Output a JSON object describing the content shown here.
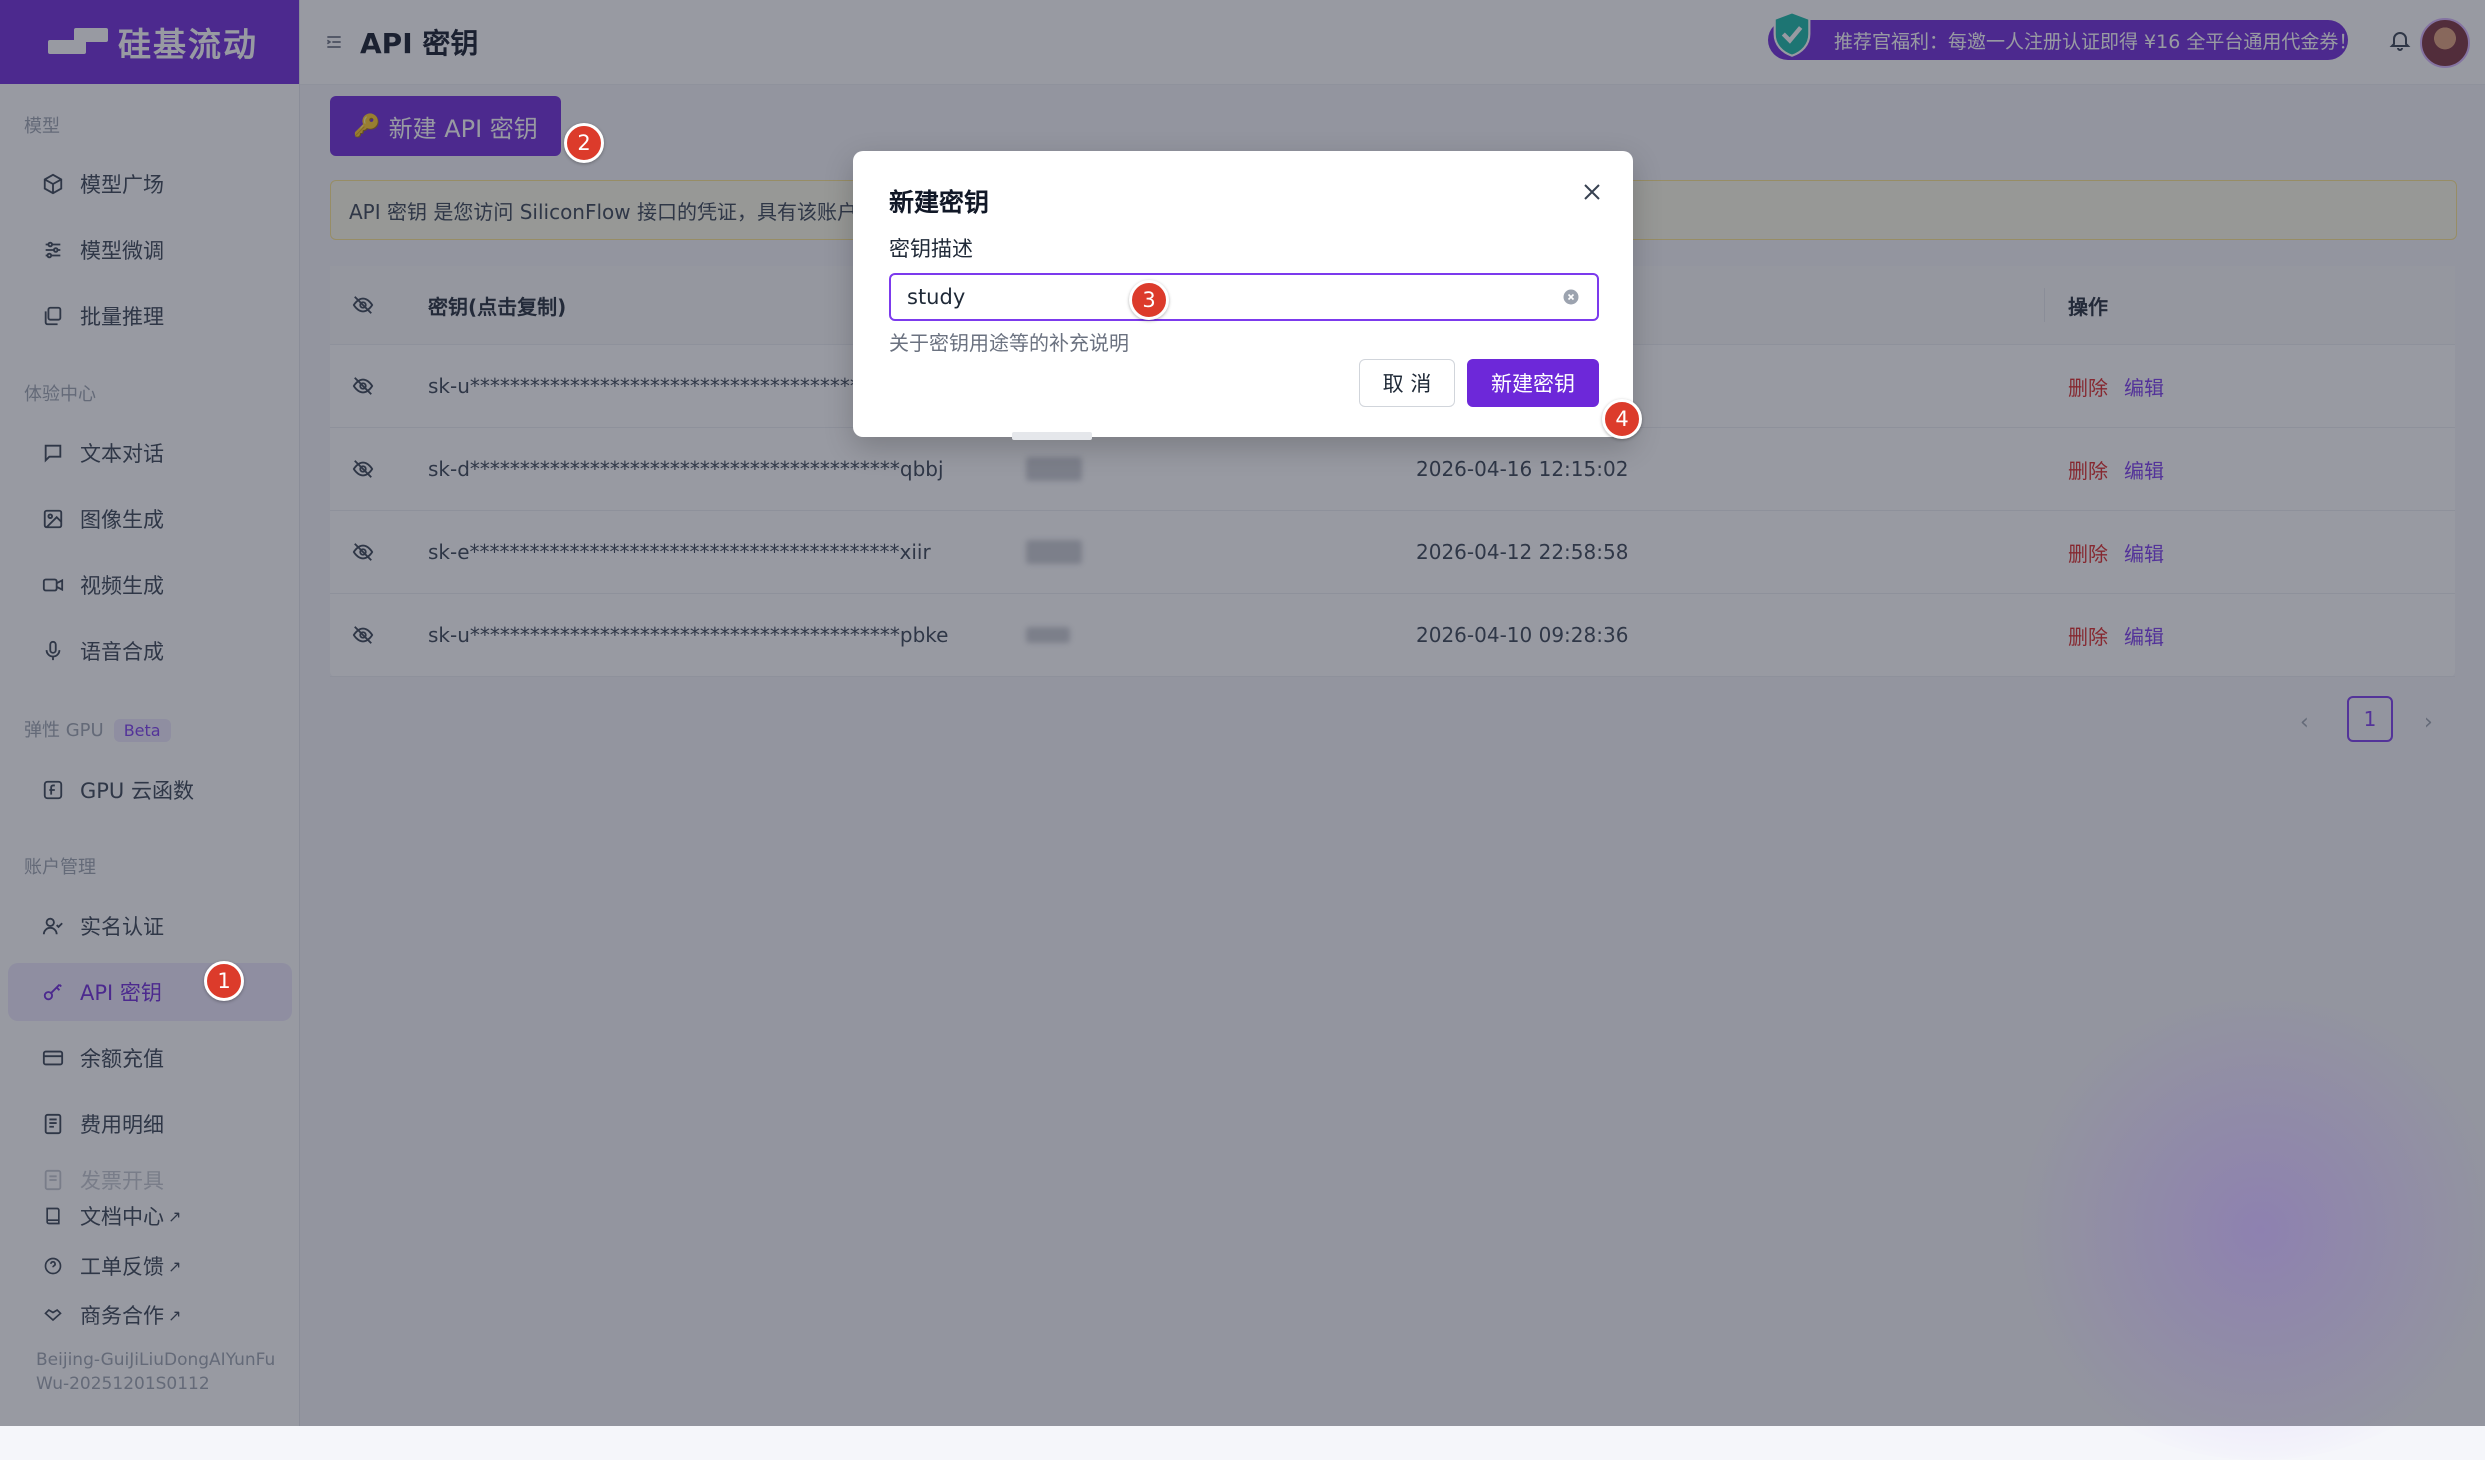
{
  "brand": {
    "name": "硅基流动"
  },
  "header": {
    "title": "API 密钥",
    "promo_text": "推荐官福利：每邀一人注册认证即得 ¥16 全平台通用代金券！"
  },
  "sidebar": {
    "sections": {
      "models": "模型",
      "experience": "体验中心",
      "gpu": "弹性 GPU",
      "gpu_badge": "Beta",
      "account": "账户管理"
    },
    "items": [
      {
        "label": "模型广场",
        "icon": "cube-icon"
      },
      {
        "label": "模型微调",
        "icon": "sliders-icon"
      },
      {
        "label": "批量推理",
        "icon": "stack-icon"
      },
      {
        "label": "文本对话",
        "icon": "chat-icon"
      },
      {
        "label": "图像生成",
        "icon": "image-icon"
      },
      {
        "label": "视频生成",
        "icon": "video-icon"
      },
      {
        "label": "语音合成",
        "icon": "mic-icon"
      },
      {
        "label": "GPU 云函数",
        "icon": "function-icon"
      },
      {
        "label": "实名认证",
        "icon": "user-check-icon"
      },
      {
        "label": "API 密钥",
        "icon": "key-icon"
      },
      {
        "label": "余额充值",
        "icon": "card-icon"
      },
      {
        "label": "费用明细",
        "icon": "receipt-icon"
      },
      {
        "label": "发票开具",
        "icon": "invoice-icon"
      }
    ],
    "links": [
      {
        "label": "文档中心",
        "suffix": "↗"
      },
      {
        "label": "工单反馈",
        "suffix": "↗"
      },
      {
        "label": "商务合作",
        "suffix": "↗"
      }
    ],
    "footer_id": "Beijing-GuiJiLiuDongAIYunFuWu-20251201S0112"
  },
  "main": {
    "new_key_button": "新建 API 密钥",
    "notice_text": "API 密钥 是您访问 SiliconFlow 接口的凭证，具有该账户",
    "table": {
      "headers": {
        "key": "密钥(点击复制)",
        "actions": "操作"
      },
      "rows": [
        {
          "key": "sk-u*******************************************r",
          "date": ""
        },
        {
          "key": "sk-d*******************************************qbbj",
          "date": "2026-04-16 12:15:02"
        },
        {
          "key": "sk-e*******************************************xiir",
          "date": "2026-04-12 22:58:58"
        },
        {
          "key": "sk-u*******************************************pbke",
          "date": "2026-04-10 09:28:36"
        }
      ],
      "action_delete": "删除",
      "action_edit": "编辑"
    },
    "pagination": {
      "prev": "‹",
      "current": "1",
      "next": "›"
    }
  },
  "modal": {
    "title": "新建密钥",
    "field_label": "密钥描述",
    "field_value": "study",
    "field_help": "关于密钥用途等的补充说明",
    "cancel_label": "取 消",
    "create_label": "新建密钥"
  },
  "markers": [
    "1",
    "2",
    "3",
    "4"
  ],
  "colors": {
    "brand": "#6d28d9",
    "danger": "#dc2626",
    "link": "#7c3aed",
    "marker": "#dc3b2b"
  }
}
